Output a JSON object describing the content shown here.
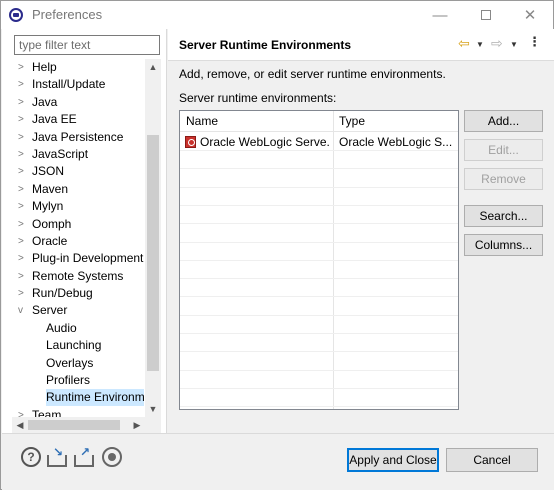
{
  "window": {
    "title": "Preferences"
  },
  "filter": {
    "placeholder": "type filter text"
  },
  "tree": {
    "items": [
      {
        "label": "Help",
        "twisty": ">",
        "child": false,
        "selected": false
      },
      {
        "label": "Install/Update",
        "twisty": ">",
        "child": false,
        "selected": false
      },
      {
        "label": "Java",
        "twisty": ">",
        "child": false,
        "selected": false
      },
      {
        "label": "Java EE",
        "twisty": ">",
        "child": false,
        "selected": false
      },
      {
        "label": "Java Persistence",
        "twisty": ">",
        "child": false,
        "selected": false
      },
      {
        "label": "JavaScript",
        "twisty": ">",
        "child": false,
        "selected": false
      },
      {
        "label": "JSON",
        "twisty": ">",
        "child": false,
        "selected": false
      },
      {
        "label": "Maven",
        "twisty": ">",
        "child": false,
        "selected": false
      },
      {
        "label": "Mylyn",
        "twisty": ">",
        "child": false,
        "selected": false
      },
      {
        "label": "Oomph",
        "twisty": ">",
        "child": false,
        "selected": false
      },
      {
        "label": "Oracle",
        "twisty": ">",
        "child": false,
        "selected": false
      },
      {
        "label": "Plug-in Development",
        "twisty": ">",
        "child": false,
        "selected": false
      },
      {
        "label": "Remote Systems",
        "twisty": ">",
        "child": false,
        "selected": false
      },
      {
        "label": "Run/Debug",
        "twisty": ">",
        "child": false,
        "selected": false
      },
      {
        "label": "Server",
        "twisty": "v",
        "child": false,
        "selected": false
      },
      {
        "label": "Audio",
        "twisty": "",
        "child": true,
        "selected": false
      },
      {
        "label": "Launching",
        "twisty": "",
        "child": true,
        "selected": false
      },
      {
        "label": "Overlays",
        "twisty": "",
        "child": true,
        "selected": false
      },
      {
        "label": "Profilers",
        "twisty": "",
        "child": true,
        "selected": false
      },
      {
        "label": "Runtime Environme",
        "twisty": "",
        "child": true,
        "selected": true
      },
      {
        "label": "Team",
        "twisty": ">",
        "child": false,
        "selected": false
      }
    ]
  },
  "page": {
    "title": "Server Runtime Environments",
    "description": "Add, remove, or edit server runtime environments.",
    "list_label": "Server runtime environments:"
  },
  "table": {
    "columns": [
      "Name",
      "Type"
    ],
    "rows": [
      {
        "name": "Oracle WebLogic Serve...",
        "type": "Oracle WebLogic S..."
      }
    ],
    "empty_rows": 14
  },
  "buttons": {
    "add": "Add...",
    "edit": "Edit...",
    "remove": "Remove",
    "search": "Search...",
    "columns": "Columns...",
    "apply_close": "Apply and Close",
    "cancel": "Cancel"
  },
  "icons": {
    "minimize": "—",
    "close": "✕",
    "back": "⇦",
    "forward": "⇨",
    "dropdown": "▼",
    "menu": "⋮",
    "help": "?"
  }
}
